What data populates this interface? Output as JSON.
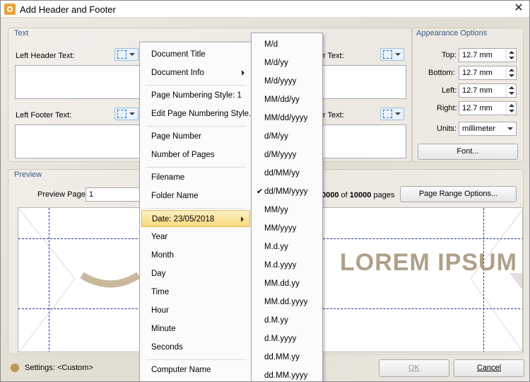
{
  "window": {
    "title": "Add Header and Footer",
    "close_glyph": "✕"
  },
  "text_group": {
    "label": "Text",
    "left_header_label": "Left Header Text:",
    "left_footer_label": "Left Footer Text:",
    "right_header_label": "r Text:",
    "right_footer_label": "r Text:"
  },
  "appearance": {
    "label": "Appearance Options",
    "top_label": "Top:",
    "top_value": "12.7 mm",
    "bottom_label": "Bottom:",
    "bottom_value": "12.7 mm",
    "left_label": "Left:",
    "left_value": "12.7 mm",
    "right_label": "Right:",
    "right_value": "12.7 mm",
    "units_label": "Units:",
    "units_value": "millimeter",
    "font_button": "Font..."
  },
  "preview": {
    "label": "Preview",
    "page_label": "Preview Page",
    "page_value": "1",
    "page_count_prefix": "0000",
    "page_count_of": "of",
    "page_count_total": "10000",
    "page_count_suffix": "pages",
    "range_button": "Page Range Options...",
    "lorem": "LOREM IPSUM"
  },
  "footer": {
    "settings_label": "Settings:",
    "settings_value": "<Custom>",
    "ok": "OK",
    "cancel": "Cancel"
  },
  "menu": {
    "items": [
      "Document Title",
      "Document Info",
      "Page Numbering Style: 1",
      "Edit Page Numbering Style...",
      "Page Number",
      "Number of Pages",
      "Filename",
      "Folder Name",
      "Date: 23/05/2018",
      "Year",
      "Month",
      "Day",
      "Time",
      "Hour",
      "Minute",
      "Seconds",
      "Computer Name"
    ]
  },
  "submenu": {
    "items": [
      "M/d",
      "M/d/yy",
      "M/d/yyyy",
      "MM/dd/yy",
      "MM/dd/yyyy",
      "d/M/yy",
      "d/M/yyyy",
      "dd/MM/yy",
      "dd/MM/yyyy",
      "MM/yy",
      "MM/yyyy",
      "M.d.yy",
      "M.d.yyyy",
      "MM.dd.yy",
      "MM.dd.yyyy",
      "d.M.yy",
      "d.M.yyyy",
      "dd.MM.yy",
      "dd.MM.yyyy"
    ],
    "checked_index": 8,
    "check_glyph": "✔"
  },
  "colors": {
    "group_label": "#3a5a8c",
    "highlight": "#f9d97c",
    "lorem": "#b0a089"
  }
}
